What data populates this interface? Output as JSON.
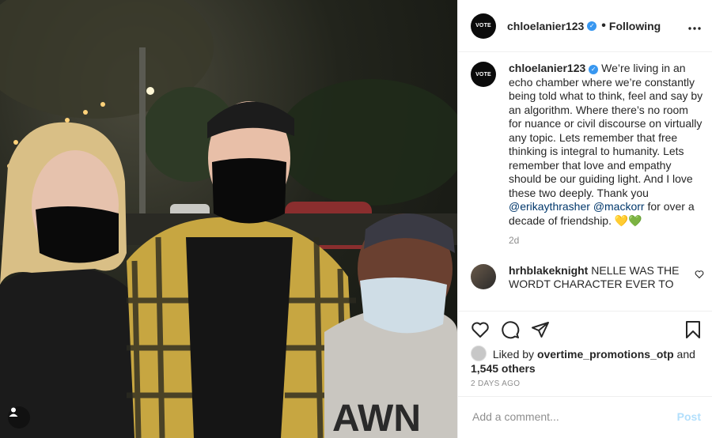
{
  "post": {
    "username": "chloelanier123",
    "avatar_text": "VOTE",
    "separator": "•",
    "follow_status": "Following",
    "more_icon": "ellipsis-icon",
    "caption_text": "We’re living in an echo chamber where we’re constantly being told what to think, feel and say by an algorithm. Where there’s no room for nuance or civil discourse on virtually any topic. Lets remember that free thinking is integral to humanity. Lets remember that love and empathy should be our guiding light. And I love these two deeply. Thank you",
    "mention_1": "@erikaythrasher",
    "mention_2": "@mackorr",
    "caption_tail": "for over a decade of friendship.",
    "emoji": "💛💚",
    "age": "2d",
    "comment": {
      "username": "hrhblakeknight",
      "text": "NELLE WAS THE WORDT CHARACTER EVER TO APPEAR ON THE SHOW!! YOU"
    },
    "likes": {
      "prefix": "Liked by",
      "user": "overtime_promotions_otp",
      "and": "and",
      "others": "1,545 others"
    },
    "date": "2 DAYS AGO",
    "add_comment_placeholder": "Add a comment...",
    "post_button": "Post"
  },
  "colors": {
    "verified": "#3897f0",
    "post_disabled": "#b2dffc",
    "mention": "#00376b"
  }
}
